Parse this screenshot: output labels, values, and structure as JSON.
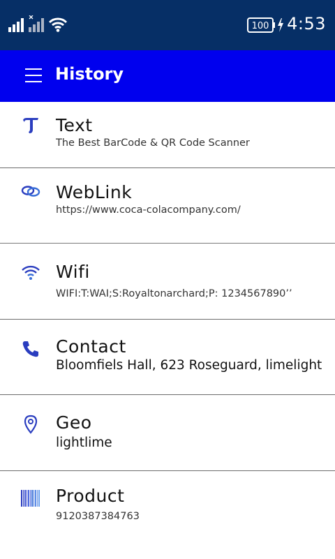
{
  "status_bar": {
    "battery": "100",
    "time": "4:53"
  },
  "app_bar": {
    "title": "History"
  },
  "history": {
    "items": [
      {
        "icon": "text-icon",
        "title": "Text",
        "value": "The Best BarCode & QR Code Scanner"
      },
      {
        "icon": "link-icon",
        "title": "WebLink",
        "value": "https://www.coca-colacompany.com/"
      },
      {
        "icon": "wifi-icon",
        "title": "Wifi",
        "value": "WIFI:T:WAI;S:Royaltonarchard;P: 1234567890’’"
      },
      {
        "icon": "phone-icon",
        "title": "Contact",
        "value": "Bloomfiels Hall, 623 Roseguard, limelight"
      },
      {
        "icon": "location-pin-icon",
        "title": "Geo",
        "value": "lightlime"
      },
      {
        "icon": "barcode-icon",
        "title": "Product",
        "value": "9120387384763"
      }
    ]
  },
  "colors": {
    "status_bar_bg": "#062f66",
    "app_bar_bg": "#0000ee",
    "icon_blue": "#2a3dbf"
  }
}
